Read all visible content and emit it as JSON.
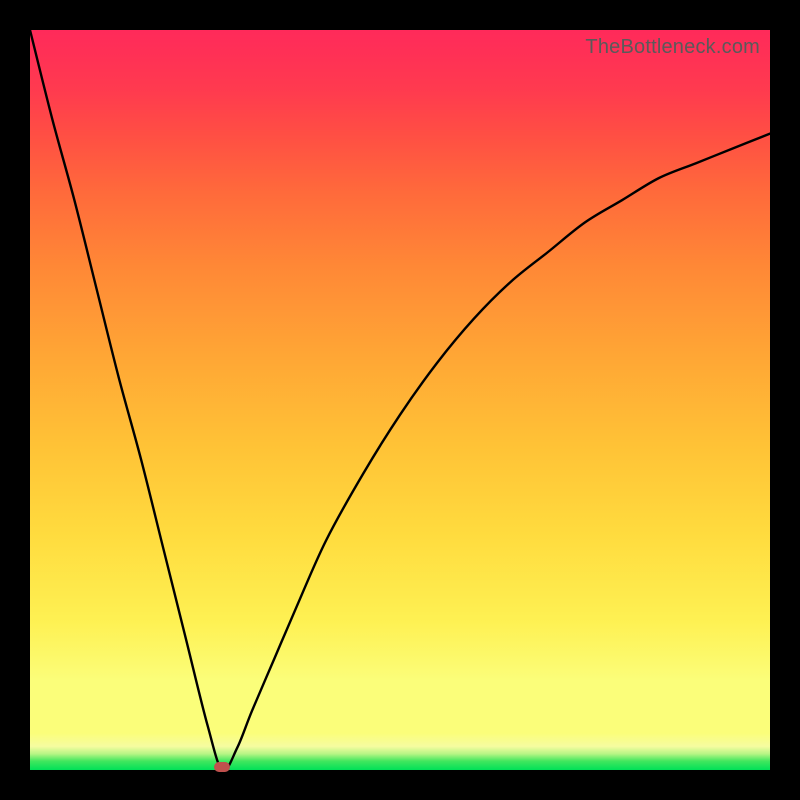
{
  "watermark": "TheBottleneck.com",
  "colors": {
    "curve_stroke": "#000000",
    "marker_fill": "#c0504d",
    "frame_bg": "#000000"
  },
  "chart_data": {
    "type": "line",
    "title": "",
    "xlabel": "",
    "ylabel": "",
    "xlim": [
      0,
      100
    ],
    "ylim": [
      0,
      100
    ],
    "grid": false,
    "legend": false,
    "annotations": [
      {
        "name": "minimum-marker",
        "x": 26,
        "y": 0
      }
    ],
    "series": [
      {
        "name": "bottleneck-curve",
        "x": [
          0,
          3,
          6,
          9,
          12,
          15,
          18,
          21,
          24,
          26,
          28,
          30,
          33,
          36,
          40,
          45,
          50,
          55,
          60,
          65,
          70,
          75,
          80,
          85,
          90,
          95,
          100
        ],
        "values": [
          100,
          88,
          77,
          65,
          53,
          42,
          30,
          18,
          6,
          0,
          3,
          8,
          15,
          22,
          31,
          40,
          48,
          55,
          61,
          66,
          70,
          74,
          77,
          80,
          82,
          84,
          86
        ]
      }
    ],
    "gradient_stops": [
      {
        "pos": 0.0,
        "color": "#00e158"
      },
      {
        "pos": 0.012,
        "color": "#41e75e"
      },
      {
        "pos": 0.022,
        "color": "#b8f585"
      },
      {
        "pos": 0.032,
        "color": "#f6fca0"
      },
      {
        "pos": 0.05,
        "color": "#fbfe7a"
      },
      {
        "pos": 0.12,
        "color": "#fbfe7a"
      },
      {
        "pos": 0.2,
        "color": "#fef153"
      },
      {
        "pos": 0.32,
        "color": "#ffdb3e"
      },
      {
        "pos": 0.44,
        "color": "#ffc236"
      },
      {
        "pos": 0.56,
        "color": "#ffa635"
      },
      {
        "pos": 0.68,
        "color": "#ff8836"
      },
      {
        "pos": 0.78,
        "color": "#ff6a3b"
      },
      {
        "pos": 0.86,
        "color": "#ff4e44"
      },
      {
        "pos": 0.92,
        "color": "#ff3a4f"
      },
      {
        "pos": 1.0,
        "color": "#ff2a5a"
      }
    ]
  }
}
